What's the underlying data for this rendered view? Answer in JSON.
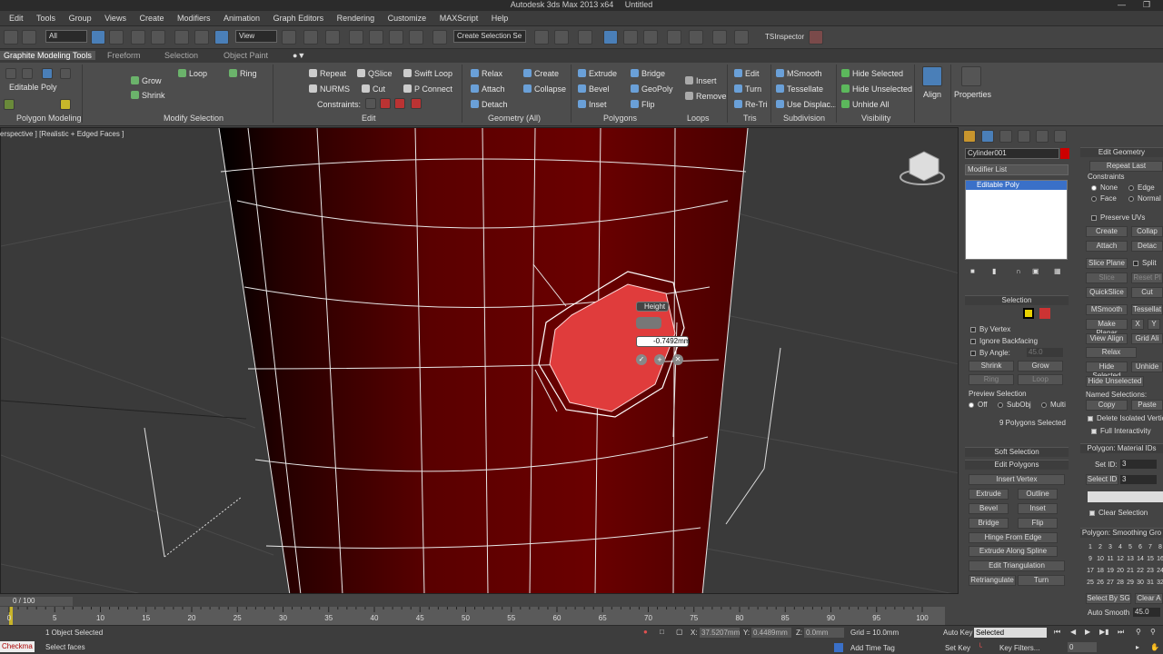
{
  "window": {
    "title": "Autodesk 3ds Max  2013 x64",
    "doc": "Untitled"
  },
  "menu": [
    "Edit",
    "Tools",
    "Group",
    "Views",
    "Create",
    "Modifiers",
    "Animation",
    "Graph Editors",
    "Rendering",
    "Customize",
    "MAXScript",
    "Help"
  ],
  "toolbar": {
    "filter_value": "All",
    "view_value": "View",
    "selection_set_placeholder": "Create Selection Se",
    "tsinspector": "TSInspector"
  },
  "ribbon_tabs": [
    "Graphite Modeling Tools",
    "Freeform",
    "Selection",
    "Object Paint"
  ],
  "ribbon": {
    "polygon_modeling": {
      "label": "Editable Poly",
      "footer": "Polygon Modeling"
    },
    "modify_selection": {
      "grow": "Grow",
      "shrink": "Shrink",
      "loop": "Loop",
      "ring": "Ring",
      "footer": "Modify Selection"
    },
    "edit": {
      "repeat": "Repeat",
      "qslice": "QSlice",
      "swift_loop": "Swift Loop",
      "nurms": "NURMS",
      "cut": "Cut",
      "pconnect": "P Connect",
      "constraints": "Constraints:",
      "footer": "Edit"
    },
    "geometry": {
      "relax": "Relax",
      "create": "Create",
      "attach": "Attach",
      "collapse": "Collapse",
      "detach": "Detach",
      "footer": "Geometry (All)"
    },
    "polygons": {
      "extrude": "Extrude",
      "bridge": "Bridge",
      "bevel": "Bevel",
      "geopoly": "GeoPoly",
      "inset": "Inset",
      "flip": "Flip",
      "insert": "Insert",
      "remove": "Remove",
      "footer": "Polygons"
    },
    "loops": {
      "footer": "Loops"
    },
    "tris": {
      "edit": "Edit",
      "turn": "Turn",
      "retri": "Re-Tri",
      "footer": "Tris"
    },
    "subdivision": {
      "msmooth": "MSmooth",
      "tessellate": "Tessellate",
      "use_displace": "Use Displac...",
      "footer": "Subdivision"
    },
    "visibility": {
      "hide_selected": "Hide Selected",
      "hide_unselected": "Hide Unselected",
      "unhide_all": "Unhide All",
      "footer": "Visibility"
    },
    "align": "Align",
    "properties": "Properties"
  },
  "viewport": {
    "label": "erspective ] [Realistic + Edged Faces ]",
    "caddy_title": "Height",
    "caddy_value": "-0.7492mm"
  },
  "command_panel": {
    "object_name": "Cylinder001",
    "modifier_list": "Modifier List",
    "stack_item": "Editable Poly",
    "selection_title": "Selection",
    "by_vertex": "By Vertex",
    "ignore_backfacing": "Ignore Backfacing",
    "by_angle": "By Angle:",
    "by_angle_value": "45.0",
    "shrink": "Shrink",
    "grow": "Grow",
    "ring": "Ring",
    "loop": "Loop",
    "preview_selection": "Preview Selection",
    "preview_off": "Off",
    "preview_subobj": "SubObj",
    "preview_multi": "Multi",
    "selected_count": "9 Polygons Selected",
    "soft_selection": "Soft Selection",
    "edit_polygons": "Edit Polygons",
    "insert_vertex": "Insert Vertex",
    "extrude": "Extrude",
    "outline": "Outline",
    "bevel": "Bevel",
    "inset": "Inset",
    "bridge": "Bridge",
    "flip": "Flip",
    "hinge_from_edge": "Hinge From Edge",
    "extrude_along_spline": "Extrude Along Spline",
    "edit_triangulation": "Edit Triangulation",
    "retriangulate": "Retriangulate",
    "turn": "Turn"
  },
  "right_panel": {
    "edit_geometry": "Edit Geometry",
    "repeat_last": "Repeat Last",
    "constraints": "Constraints",
    "none": "None",
    "edge": "Edge",
    "face": "Face",
    "normal": "Normal",
    "preserve_uvs": "Preserve UVs",
    "create": "Create",
    "collapse": "Collap",
    "attach": "Attach",
    "detach": "Detac",
    "slice_plane": "Slice Plane",
    "split": "Split",
    "slice": "Slice",
    "reset_plane": "Reset Pl",
    "quickslice": "QuickSlice",
    "cut": "Cut",
    "msmooth": "MSmooth",
    "tessellate": "Tessellat",
    "make_planar": "Make Planar",
    "x": "X",
    "y": "Y",
    "view_align": "View Align",
    "grid_align": "Grid Ali",
    "relax": "Relax",
    "hide_selected": "Hide Selected",
    "unhide": "Unhide",
    "hide_unselected": "Hide Unselected",
    "named_selections": "Named Selections:",
    "copy": "Copy",
    "paste": "Paste",
    "delete_isolated": "Delete Isolated Vertic",
    "full_interactivity": "Full Interactivity",
    "material_ids": "Polygon: Material IDs",
    "set_id": "Set ID:",
    "set_id_value": "3",
    "select_id": "Select ID",
    "select_id_value": "3",
    "clear_selection": "Clear Selection",
    "smoothing_groups": "Polygon: Smoothing Gro",
    "sg_numbers": [
      "1",
      "2",
      "3",
      "4",
      "5",
      "6",
      "7",
      "8",
      "9",
      "10",
      "11",
      "12",
      "13",
      "14",
      "15",
      "16",
      "17",
      "18",
      "19",
      "20",
      "21",
      "22",
      "23",
      "24",
      "25",
      "26",
      "27",
      "28",
      "29",
      "30",
      "31",
      "32"
    ],
    "select_by_sg": "Select By SG",
    "clear_all": "Clear A",
    "auto_smooth": "Auto Smooth",
    "auto_smooth_value": "45.0"
  },
  "timeline": {
    "frame": "0 / 100",
    "ticks": [
      "0",
      "5",
      "10",
      "15",
      "20",
      "25",
      "30",
      "35",
      "40",
      "45",
      "50",
      "55",
      "60",
      "65",
      "70",
      "75",
      "80",
      "85",
      "90",
      "95",
      "100"
    ]
  },
  "status": {
    "checkmate": "Checkma",
    "objects_selected": "1 Object Selected",
    "prompt": "Select faces",
    "x_label": "X:",
    "x_value": "37.5207mm",
    "y_label": "Y:",
    "y_value": "0.4489mm",
    "z_label": "Z:",
    "z_value": "0.0mm",
    "grid": "Grid = 10.0mm",
    "add_time_tag": "Add Time Tag",
    "auto_key": "Auto Key",
    "selected": "Selected",
    "set_key": "Set Key",
    "key_filters": "Key Filters...",
    "frame_value": "0"
  }
}
